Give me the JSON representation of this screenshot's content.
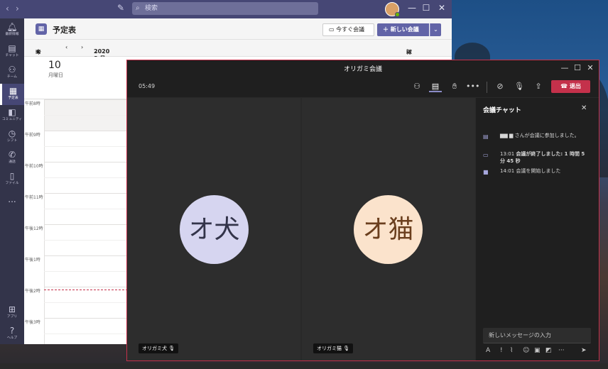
{
  "titlebar": {
    "nav_back": "‹",
    "nav_forward": "›",
    "search_placeholder": "検索",
    "minimize": "—",
    "maximize": "☐",
    "close": "✕"
  },
  "rail": {
    "items": [
      {
        "icon": "bell-icon",
        "label": "最新情報"
      },
      {
        "icon": "chat-icon",
        "label": "チャット"
      },
      {
        "icon": "teams-icon",
        "label": "チーム"
      },
      {
        "icon": "calendar-icon",
        "label": "予定表"
      },
      {
        "icon": "community-icon",
        "label": "コミュニティ"
      },
      {
        "icon": "shifts-icon",
        "label": "シフト"
      },
      {
        "icon": "phone-icon",
        "label": "通話"
      },
      {
        "icon": "file-icon",
        "label": "ファイル"
      },
      {
        "icon": "more-icon",
        "label": "..."
      }
    ],
    "apps_label": "アプリ",
    "help_label": "ヘルプ"
  },
  "calendar": {
    "title": "予定表",
    "meet_now": "今すぐ会議",
    "new_meeting": "新しい会議",
    "today": "今日",
    "month": "2020 8 月",
    "view": "稼働日",
    "date_num": "10",
    "date_day": "月曜日",
    "hours": [
      "午前8時",
      "午前9時",
      "午前10時",
      "午前11時",
      "午後12時",
      "午後1時",
      "午後2時",
      "午後3時"
    ]
  },
  "meeting": {
    "title": "オリガミ会議",
    "timer": "05:49",
    "leave_label": "退出",
    "participants": [
      {
        "initials": "オ犬",
        "name": "オリガミ犬"
      },
      {
        "initials": "オ猫",
        "name": "オリガミ猫"
      }
    ]
  },
  "chat": {
    "title": "会議チャット",
    "messages": [
      {
        "icon": "join-icon",
        "text": "▆▆ ▆ さんが会議に参加しました。"
      },
      {
        "icon": "video-end-icon",
        "time": "13:01",
        "text": "会議が終了しました: 1 時間 5 分 45 秒"
      },
      {
        "icon": "video-start-icon",
        "time": "14:01",
        "text": "会議を開始しました"
      }
    ],
    "input_placeholder": "新しいメッセージの入力"
  },
  "colors": {
    "brand": "#6264a7",
    "titlebar": "#464775",
    "leave": "#c4314b",
    "meeting_bg": "#292929"
  }
}
